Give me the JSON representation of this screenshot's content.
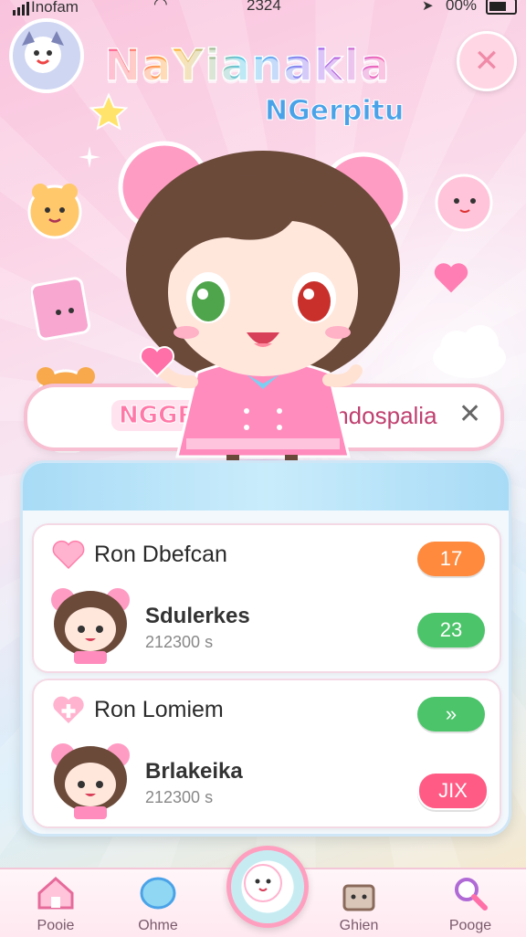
{
  "status_bar": {
    "carrier": "Inofam",
    "time": "2324",
    "battery": "00%"
  },
  "header": {
    "title": "NaYianakla",
    "subtitle": "NGerpitu",
    "close_icon": "close-icon"
  },
  "search": {
    "label": "NGGRRA",
    "value": "Indospalia",
    "clear_icon": "close-icon"
  },
  "cards": [
    {
      "icon": "heart-icon",
      "title": "Ron Dbefcan",
      "name": "Sdulerkes",
      "sub": "212300 s",
      "badge": "17",
      "badge_color": "#ff8a3d"
    },
    {
      "icon": "plus-icon",
      "title": "Ron Lomiem",
      "name": "Brlakeika",
      "sub": "212300 s",
      "badge_top": "»",
      "badge_top_color": "#4cc46a",
      "badge": "JIX",
      "badge_color": "#ff5b84"
    }
  ],
  "card_badge_2_color": "#4cc46a",
  "card_badge_2_value": "23",
  "nav": {
    "items": [
      {
        "label": "Pooie",
        "icon": "home-icon"
      },
      {
        "label": "Ohme",
        "icon": "bubble-icon"
      },
      {
        "label": "Ghien",
        "icon": "bag-icon"
      },
      {
        "label": "Pooge",
        "icon": "search-icon"
      }
    ],
    "center_icon": "mascot-icon"
  },
  "colors": {
    "accent_pink": "#ff79a8",
    "accent_blue": "#4aa3e8",
    "panel_header": "#a8dbf6"
  }
}
